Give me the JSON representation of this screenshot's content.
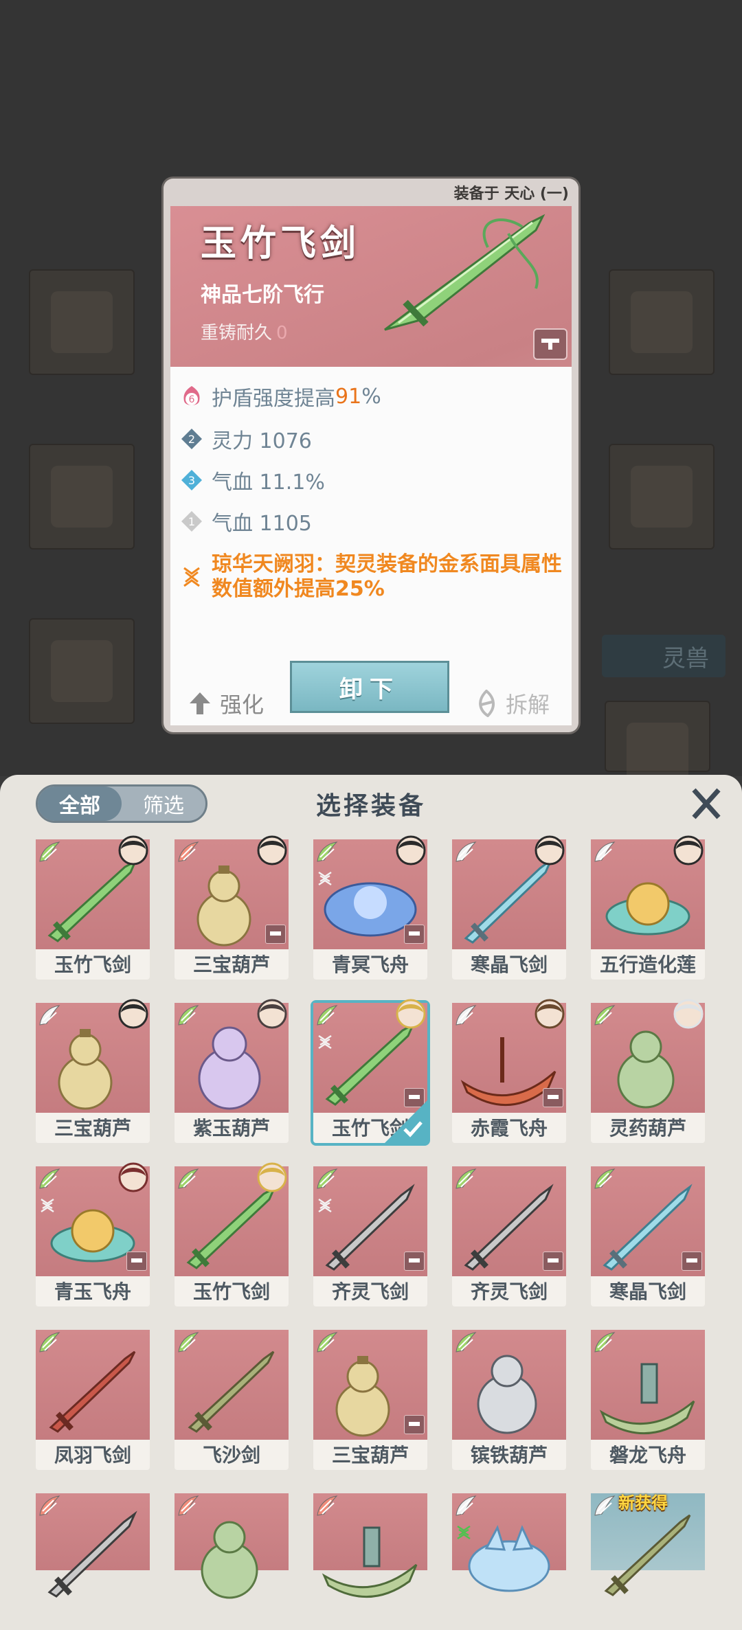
{
  "background": {
    "side_tab_label": "灵兽"
  },
  "detail": {
    "equipped_on": "装备于 天心 (一)",
    "name": "玉竹飞剑",
    "grade": "神品七阶飞行",
    "durability_label": "重铸耐久",
    "durability_value": "0",
    "stats": [
      {
        "badge": "6",
        "label": "护盾强度提高 ",
        "value": "91",
        "suffix": "%",
        "badge_color": "#e06a8a"
      },
      {
        "badge": "2",
        "label": "灵力 1076",
        "value": "",
        "suffix": "",
        "badge_color": "#5f7d92"
      },
      {
        "badge": "3",
        "label": "气血 11.1%",
        "value": "",
        "suffix": "",
        "badge_color": "#4fb0d8"
      },
      {
        "badge": "1",
        "label": "气血 1105",
        "value": "",
        "suffix": "",
        "badge_color": "#b8b8b8"
      }
    ],
    "special": "琼华天阙羽：契灵装备的金系面具属性数值额外提高25%",
    "strengthen_label": "强化",
    "unequip_label": "卸下",
    "dismantle_label": "拆解"
  },
  "panel": {
    "filter_all": "全部",
    "filter_screen": "筛选",
    "title": "选择装备",
    "items": [
      {
        "name": "玉竹飞剑",
        "kind": "sword-green",
        "wing": "green",
        "avatar": "dark"
      },
      {
        "name": "三宝葫芦",
        "kind": "gourd-gold",
        "wing": "red",
        "avatar": "dark",
        "lock": true
      },
      {
        "name": "青冥飞舟",
        "kind": "boat-blue",
        "wing": "green",
        "avatar": "dark",
        "lock": true,
        "set": true
      },
      {
        "name": "寒晶飞剑",
        "kind": "sword-ice",
        "wing": "white",
        "avatar": "dark"
      },
      {
        "name": "五行造化莲",
        "kind": "lotus",
        "wing": "white",
        "avatar": "dark"
      },
      {
        "name": "三宝葫芦",
        "kind": "gourd-gold",
        "wing": "white",
        "avatar": "dark"
      },
      {
        "name": "紫玉葫芦",
        "kind": "gourd-purple",
        "wing": "green",
        "avatar": "cat"
      },
      {
        "name": "玉竹飞剑",
        "kind": "sword-green",
        "wing": "green",
        "avatar": "gold",
        "lock": true,
        "set": true,
        "selected": true
      },
      {
        "name": "赤霞飞舟",
        "kind": "boat-red",
        "wing": "white",
        "avatar": "brown",
        "lock": true
      },
      {
        "name": "灵药葫芦",
        "kind": "gourd-green",
        "wing": "green",
        "avatar": "white"
      },
      {
        "name": "青玉飞舟",
        "kind": "lotus",
        "wing": "green",
        "avatar": "red",
        "lock": true,
        "set": true
      },
      {
        "name": "玉竹飞剑",
        "kind": "sword-green",
        "wing": "green",
        "avatar": "gold"
      },
      {
        "name": "齐灵飞剑",
        "kind": "sword-steel",
        "wing": "green",
        "lock": true,
        "set": true
      },
      {
        "name": "齐灵飞剑",
        "kind": "sword-steel",
        "wing": "green",
        "lock": true
      },
      {
        "name": "寒晶飞剑",
        "kind": "sword-ice",
        "wing": "green",
        "lock": true
      },
      {
        "name": "凤羽飞剑",
        "kind": "sword-red",
        "wing": "green"
      },
      {
        "name": "飞沙剑",
        "kind": "sword-olive",
        "wing": "green"
      },
      {
        "name": "三宝葫芦",
        "kind": "gourd-gold",
        "wing": "green",
        "lock": true
      },
      {
        "name": "镔铁葫芦",
        "kind": "gourd-steel",
        "wing": "green"
      },
      {
        "name": "磐龙飞舟",
        "kind": "boat-green",
        "wing": "green"
      },
      {
        "name": "",
        "kind": "sword-steel",
        "wing": "red"
      },
      {
        "name": "",
        "kind": "gourd-green",
        "wing": "red"
      },
      {
        "name": "",
        "kind": "boat-green",
        "wing": "red"
      },
      {
        "name": "",
        "kind": "fox-blue",
        "wing": "white",
        "set_green": true
      },
      {
        "name": "",
        "kind": "sword-olive",
        "wing": "white",
        "badge": "新获得",
        "teal": true
      }
    ]
  }
}
